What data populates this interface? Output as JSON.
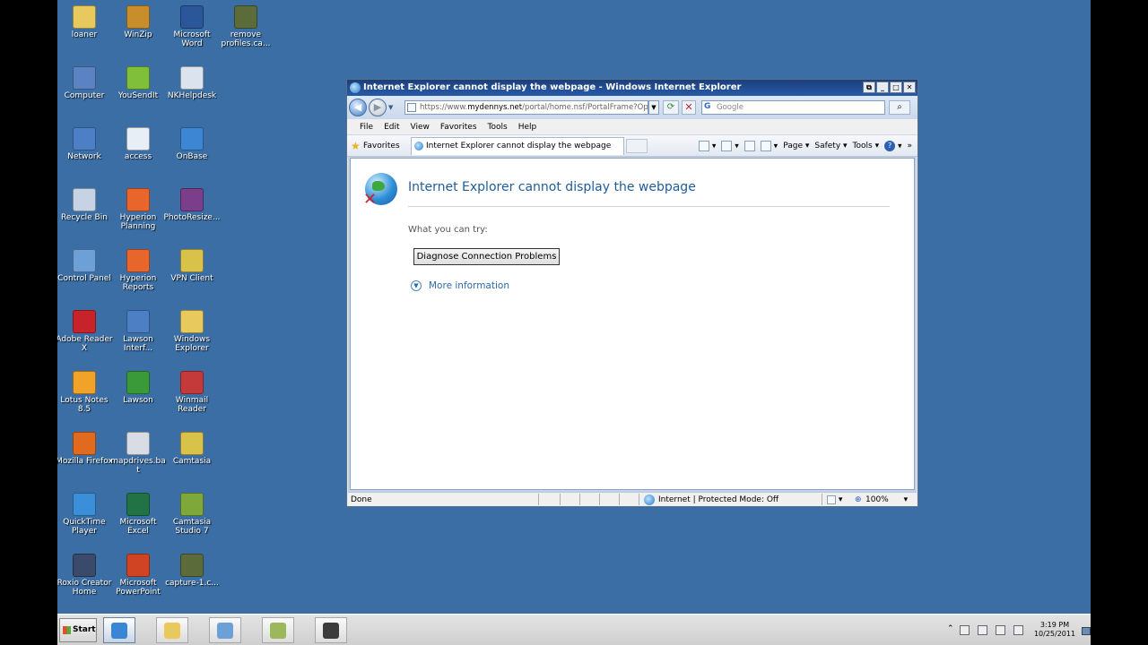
{
  "desktop": {
    "icons": [
      {
        "label": "loaner",
        "name": "folder-icon",
        "color": "#e8c95d"
      },
      {
        "label": "WinZip",
        "name": "winzip-icon",
        "color": "#c98e2c"
      },
      {
        "label": "Microsoft Word",
        "name": "word-icon",
        "color": "#2b579a"
      },
      {
        "label": "remove profiles.ca...",
        "name": "script-file-icon",
        "color": "#5c6b3a"
      },
      {
        "label": "Computer",
        "name": "computer-icon",
        "color": "#5b83c4"
      },
      {
        "label": "YouSendIt",
        "name": "yousendit-icon",
        "color": "#7fbf3a"
      },
      {
        "label": "NKHelpdesk",
        "name": "helpdesk-icon",
        "color": "#dbe3ee"
      },
      {
        "label": "Network",
        "name": "network-icon",
        "color": "#4d7fc7"
      },
      {
        "label": "access",
        "name": "access-shortcut-icon",
        "color": "#e8eef5"
      },
      {
        "label": "OnBase",
        "name": "onbase-icon",
        "color": "#3c86d4"
      },
      {
        "label": "Recycle Bin",
        "name": "recycle-bin-icon",
        "color": "#c6d3e4"
      },
      {
        "label": "Hyperion Planning",
        "name": "hyperion-planning-icon",
        "color": "#e8662c"
      },
      {
        "label": "PhotoResize...",
        "name": "photoresize-icon",
        "color": "#7a3e8a"
      },
      {
        "label": "Control Panel",
        "name": "control-panel-icon",
        "color": "#6ea0d8"
      },
      {
        "label": "Hyperion Reports",
        "name": "hyperion-reports-icon",
        "color": "#e8662c"
      },
      {
        "label": "VPN Client",
        "name": "vpn-client-icon",
        "color": "#d9c24a"
      },
      {
        "label": "Adobe Reader X",
        "name": "adobe-reader-icon",
        "color": "#c8222a"
      },
      {
        "label": "Lawson Interf...",
        "name": "lawson-interface-icon",
        "color": "#4c7fc4"
      },
      {
        "label": "Windows Explorer",
        "name": "windows-explorer-icon",
        "color": "#e8c95d"
      },
      {
        "label": "Lotus Notes 8.5",
        "name": "lotus-notes-icon",
        "color": "#f0a229"
      },
      {
        "label": "Lawson",
        "name": "lawson-icon",
        "color": "#3a9a3a"
      },
      {
        "label": "Winmail Reader",
        "name": "winmail-reader-icon",
        "color": "#c43a3a"
      },
      {
        "label": "Mozilla Firefox",
        "name": "firefox-icon",
        "color": "#e06a1e"
      },
      {
        "label": "mapdrives.bat",
        "name": "batch-file-icon",
        "color": "#d8dde5"
      },
      {
        "label": "Camtasia",
        "name": "camtasia-folder-icon",
        "color": "#d9c24a"
      },
      {
        "label": "QuickTime Player",
        "name": "quicktime-icon",
        "color": "#3a8fd8"
      },
      {
        "label": "Microsoft Excel",
        "name": "excel-icon",
        "color": "#217346"
      },
      {
        "label": "Camtasia Studio 7",
        "name": "camtasia-studio-icon",
        "color": "#7fa83a"
      },
      {
        "label": "Roxio Creator Home",
        "name": "roxio-icon",
        "color": "#3a4a6a"
      },
      {
        "label": "Microsoft PowerPoint",
        "name": "powerpoint-icon",
        "color": "#d04423"
      },
      {
        "label": "capture-1.c...",
        "name": "capture-file-icon",
        "color": "#5c6b3a"
      }
    ]
  },
  "window": {
    "title": "Internet Explorer cannot display the webpage - Windows Internet Explorer",
    "address": {
      "prefix": "https://www.",
      "domain": "mydennys.net",
      "suffix": "/portal/home.nsf/PortalFrame?OpenF"
    },
    "search_placeholder": "Google",
    "menu": [
      "File",
      "Edit",
      "View",
      "Favorites",
      "Tools",
      "Help"
    ],
    "favorites_label": "Favorites",
    "tab_label": "Internet Explorer cannot display the webpage",
    "commands": {
      "page": "Page ▾",
      "safety": "Safety ▾",
      "tools": "Tools ▾"
    },
    "content": {
      "error_title": "Internet Explorer cannot display the webpage",
      "what_you_can_try": "What you can try:",
      "diagnose_button": "Diagnose Connection Problems",
      "more_info": "More information"
    },
    "status": {
      "text": "Done",
      "zone": "Internet | Protected Mode: Off",
      "zoom": "100%"
    }
  },
  "taskbar": {
    "start_label": "Start",
    "buttons": [
      {
        "name": "taskbar-ie-button",
        "color": "#3a86d4"
      },
      {
        "name": "taskbar-explorer-button",
        "color": "#e8c95d"
      },
      {
        "name": "taskbar-control-panel-button",
        "color": "#6ea0d8"
      },
      {
        "name": "taskbar-camtasia-button",
        "color": "#9cb85a"
      },
      {
        "name": "taskbar-recorder-button",
        "color": "#3c3c3c"
      }
    ],
    "clock_time": "3:19 PM",
    "clock_date": "10/25/2011"
  }
}
